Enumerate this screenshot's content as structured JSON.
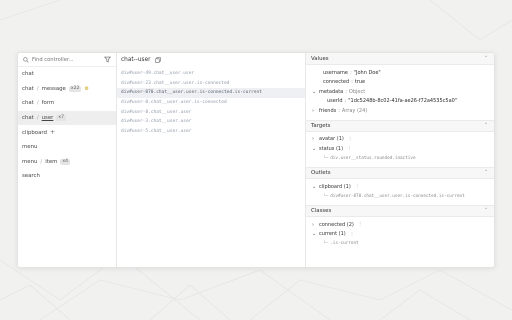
{
  "sidebar": {
    "search_placeholder": "Find controller...",
    "items": [
      {
        "label": "chat"
      },
      {
        "label": "chat",
        "sep": "/",
        "tail": "message",
        "badge": "x22"
      },
      {
        "label": "chat",
        "sep": "/",
        "tail": "form"
      },
      {
        "label": "chat",
        "sep": "/",
        "tail": "user",
        "badge": "x7"
      },
      {
        "label": "clipboard"
      },
      {
        "label": "menu"
      },
      {
        "label": "menu",
        "sep": "/",
        "tail": "item",
        "badge": "x4"
      },
      {
        "label": "search"
      }
    ]
  },
  "middle": {
    "title": "chat--user",
    "elements": [
      "div#user-49.chat__user.user",
      "div#user-23.chat__user.user.is-connected",
      "div#user-870.chat__user.user.is-connected.is-current",
      "div#user-8.chat__user.user.is-connected",
      "div#user-8.chat__user.user",
      "div#user-3.chat__user.user",
      "div#user-5.chat__user.user"
    ]
  },
  "values": {
    "header": "Values",
    "username_key": "username",
    "username_val": "\"John Doe\"",
    "connected_key": "connected",
    "connected_val": "true",
    "metadata_key": "metadata",
    "metadata_val": "Object",
    "userid_key": "userId",
    "userid_val": "\"1dc5248b-8c02-41fa-ae26-f72a4535c5a0\"",
    "friends_key": "friends",
    "friends_val": "Array (24)"
  },
  "targets": {
    "header": "Targets",
    "avatar_label": "avatar (1)",
    "status_label": "status (1)",
    "status_child": "div.user__status.rounded.inactive"
  },
  "outlets": {
    "header": "Outlets",
    "clipboard_label": "clipboard (1)",
    "clipboard_child": "div#user-870.chat__user.user.is-connected.is-current"
  },
  "classes": {
    "header": "Classes",
    "connected_label": "connected (2)",
    "current_label": "current (1)",
    "current_child": ".is-current"
  }
}
